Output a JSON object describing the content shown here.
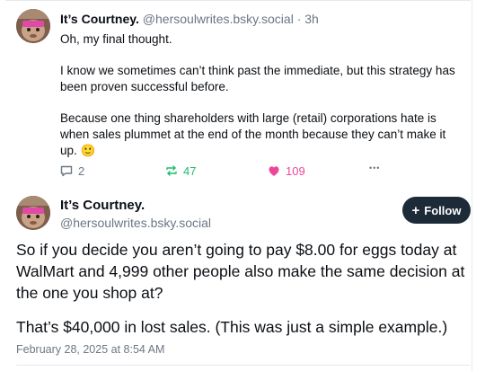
{
  "post1": {
    "author_name": "It’s Courtney.",
    "author_handle": "@hersoulwrites.bsky.social",
    "separator": "·",
    "time_ago": "3h",
    "paragraphs": [
      "Oh, my final thought.",
      "I know we sometimes can’t think past the immediate, but this strategy has been proven successful before.",
      "Because one thing shareholders with large (retail) corporations hate is when sales plummet at the end of the month because they can’t make it up. 🙂"
    ],
    "reply_count": "2",
    "repost_count": "47",
    "like_count": "109",
    "more_icon_glyph": "•••"
  },
  "post2": {
    "author_name": "It’s Courtney.",
    "author_handle": "@hersoulwrites.bsky.social",
    "follow_label": "Follow",
    "follow_icon_glyph": "+",
    "paragraphs": [
      "So if you decide you aren’t going to pay $8.00 for eggs today at WalMart and 4,999 other people also make the same decision at the one you shop at?",
      "That’s $40,000 in lost sales. (This was just a simple example.)"
    ],
    "timestamp": "February 28, 2025 at 8:54 AM"
  },
  "colors": {
    "repost": "#20bc6c",
    "like": "#ec4899",
    "muted": "#6b7785",
    "follow_bg": "#1d2a38"
  },
  "icons": [
    "avatar",
    "reply-icon",
    "repost-icon",
    "heart-icon",
    "more-icon",
    "plus-icon"
  ]
}
